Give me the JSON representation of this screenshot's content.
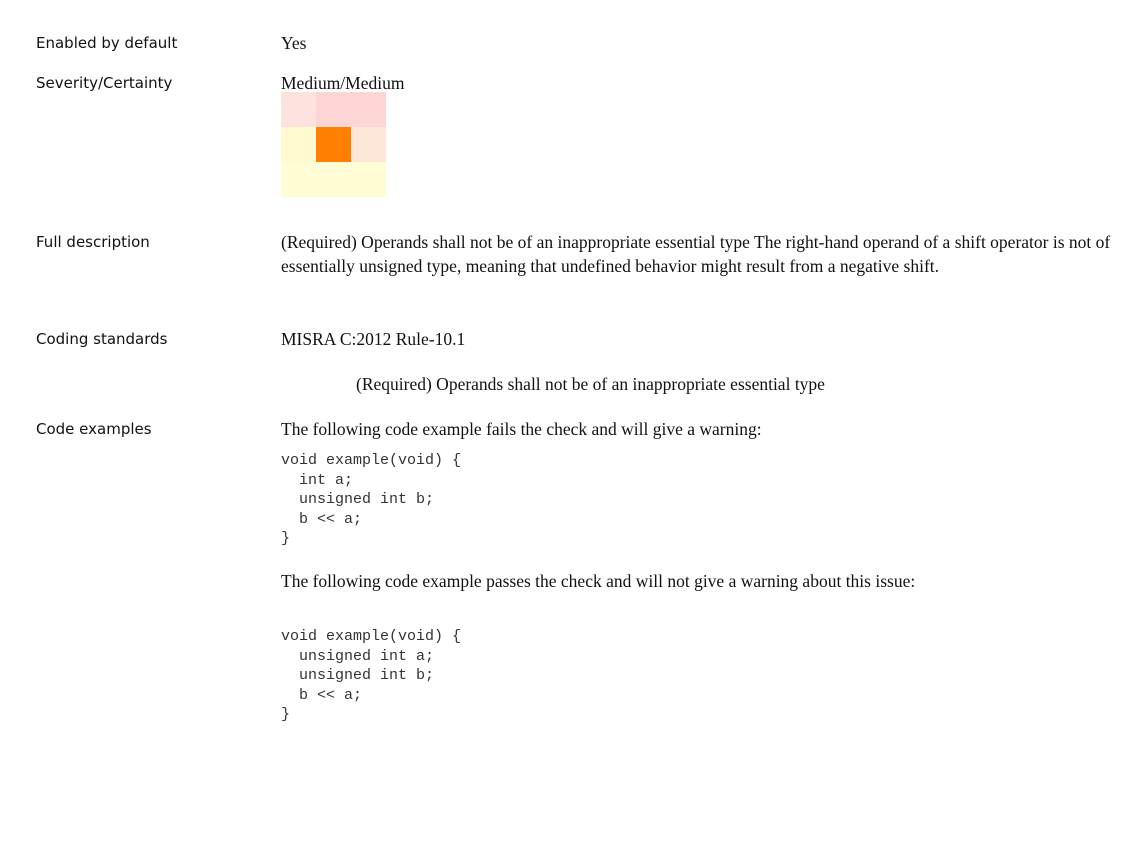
{
  "fields": {
    "enabled": {
      "label": "Enabled by default",
      "value": "Yes"
    },
    "severity": {
      "label": "Severity/Certainty",
      "value": "Medium/Medium"
    },
    "description": {
      "label": "Full description",
      "value": "(Required) Operands shall not be of an inappropriate essential type The right-hand operand of a shift operator is not of essentially unsigned type, meaning that undefined behavior might result from a negative shift."
    },
    "standards": {
      "label": "Coding standards",
      "value": "MISRA C:2012 Rule-10.1",
      "detail": "(Required) Operands shall not be of an inappropriate essential type"
    },
    "examples": {
      "label": "Code examples",
      "fail_intro": "The following code example fails the check and will give a warning:",
      "fail_code": "void example(void) {\n  int a;\n  unsigned int b;\n  b << a;\n}",
      "pass_intro": "The following code example passes the check and will not give a warning about this issue:",
      "pass_code": "void example(void) {\n  unsigned int a;\n  unsigned int b;\n  b << a;\n}"
    }
  },
  "severity_grid": {
    "colors": [
      [
        "#fde2de",
        "#fdd5d5",
        "#fdd5d5"
      ],
      [
        "#fffad0",
        "#ff7f00",
        "#fde6d8"
      ],
      [
        "#fffcd6",
        "#fffcd6",
        "#fffcd6"
      ]
    ],
    "selected_cell": {
      "row": 1,
      "col": 1
    }
  }
}
